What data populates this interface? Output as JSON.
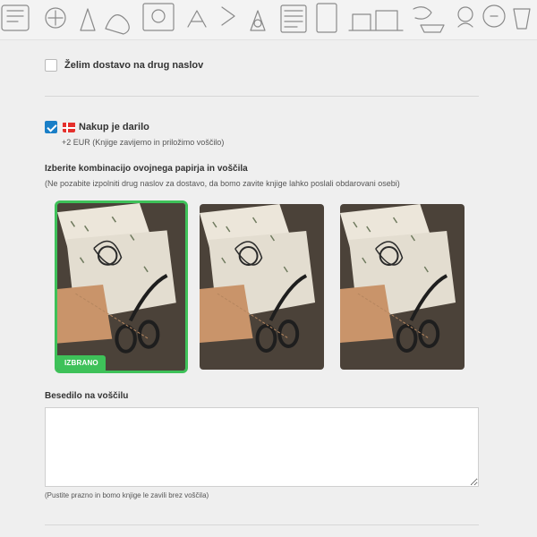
{
  "delivery": {
    "other_address_label": "Želim dostavo na drug naslov",
    "other_address_checked": false
  },
  "gift": {
    "label": "Nakup je darilo",
    "checked": true,
    "icon": "gift-flag-icon",
    "price_note": "+2 EUR (Knjige zavijemo in priložimo voščilo)"
  },
  "wrap": {
    "title": "Izberite kombinacijo ovojnega papirja in voščila",
    "hint": "(Ne pozabite izpolniti drug naslov za dostavo, da bomo zavite knjige lahko poslali obdarovani osebi)",
    "options": [
      {
        "image": "gift-wrap-photo",
        "selected": true
      },
      {
        "image": "gift-wrap-photo",
        "selected": false
      },
      {
        "image": "gift-wrap-photo",
        "selected": false
      }
    ],
    "selected_badge": "IZBRANO"
  },
  "card": {
    "title": "Besedilo na voščilu",
    "value": "",
    "hint": "(Pustite prazno in bomo knjige le zavili brez voščila)"
  },
  "colors": {
    "accent_green": "#3ec159",
    "checkbox_blue": "#1a7fc7",
    "background": "#efefef"
  }
}
